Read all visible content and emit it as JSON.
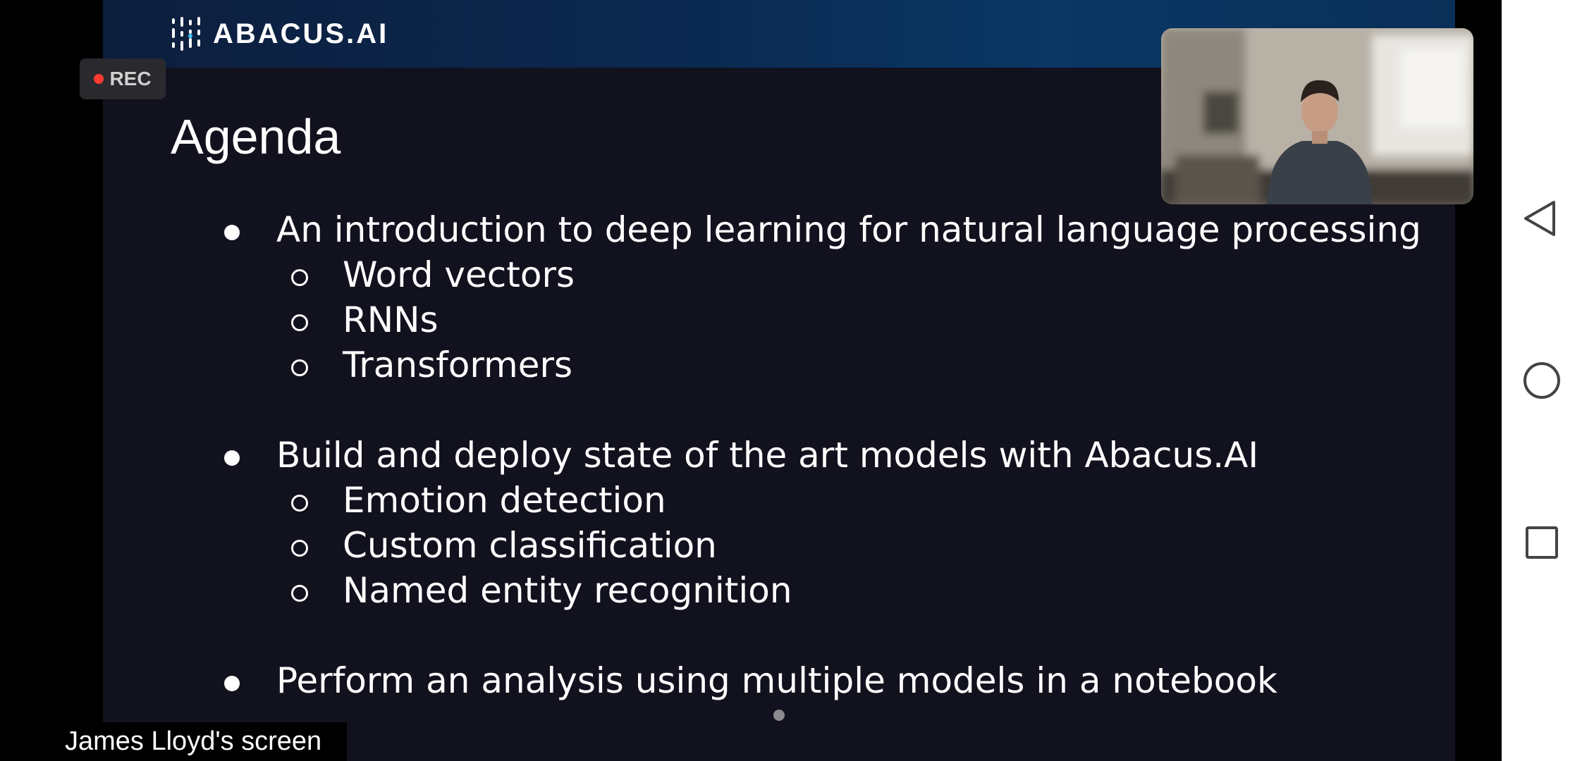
{
  "slide": {
    "brand": "ABACUS.AI",
    "title": "Agenda",
    "sections": [
      {
        "text": "An introduction to deep learning for natural language processing",
        "subitems": [
          "Word vectors",
          "RNNs",
          "Transformers"
        ]
      },
      {
        "text": "Build and deploy state of the art models with Abacus.AI",
        "subitems": [
          "Emotion detection",
          "Custom classification",
          "Named entity recognition"
        ]
      },
      {
        "text": "Perform an analysis using multiple models in a notebook",
        "subitems": []
      }
    ]
  },
  "recording": {
    "label": "REC",
    "dot_color": "#ff3b30"
  },
  "screen_share": {
    "owner_label": "James Lloyd's screen"
  },
  "icons": {
    "nav_back": "back-triangle-icon",
    "nav_home": "home-circle-icon",
    "nav_recents": "recents-square-icon",
    "logo": "abacus-logo-icon"
  },
  "colors": {
    "slide_background": "#12121f",
    "header_gradient_dark": "#0d1e3d",
    "header_gradient_light": "#0a3764",
    "text": "#ffffff",
    "nav_bar": "#ffffff"
  }
}
